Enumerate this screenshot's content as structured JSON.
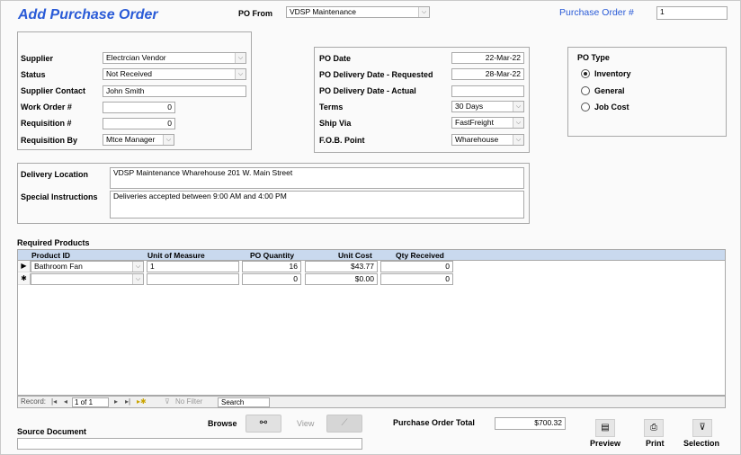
{
  "form": {
    "title": "Add Purchase Order",
    "po_from_label": "PO From",
    "po_from_value": "VDSP Maintenance",
    "po_number_label": "Purchase Order #",
    "po_number_value": "1"
  },
  "supplier_section": {
    "supplier_label": "Supplier",
    "supplier_value": "Electrcian Vendor",
    "status_label": "Status",
    "status_value": "Not Received",
    "contact_label": "Supplier Contact",
    "contact_value": "John Smith",
    "work_order_label": "Work Order #",
    "work_order_value": "0",
    "requisition_label": "Requisition #",
    "requisition_value": "0",
    "requisition_by_label": "Requisition By",
    "requisition_by_value": "Mtce Manager"
  },
  "dates_section": {
    "po_date_label": "PO Date",
    "po_date_value": "22-Mar-22",
    "delivery_requested_label": "PO Delivery Date - Requested",
    "delivery_requested_value": "28-Mar-22",
    "delivery_actual_label": "PO Delivery Date - Actual",
    "delivery_actual_value": "",
    "terms_label": "Terms",
    "terms_value": "30 Days",
    "ship_via_label": "Ship Via",
    "ship_via_value": "FastFreight",
    "fob_label": "F.O.B. Point",
    "fob_value": "Wharehouse"
  },
  "po_type": {
    "label": "PO Type",
    "options": [
      "Inventory",
      "General",
      "Job Cost"
    ],
    "selected": "Inventory"
  },
  "delivery": {
    "location_label": "Delivery Location",
    "location_value": "VDSP Maintenance Wharehouse 201 W. Main Street",
    "instructions_label": "Special Instructions",
    "instructions_value": "Deliveries accepted between 9:00 AM and 4:00 PM"
  },
  "products": {
    "section_label": "Required Products",
    "columns": [
      "Product ID",
      "Unit of Measure",
      "PO Quantity",
      "Unit Cost",
      "Qty Received"
    ],
    "rows": [
      {
        "selector": "▶",
        "product_id": "Bathroom Fan",
        "unit": "1",
        "quantity": "16",
        "unit_cost": "$43.77",
        "qty_received": "0"
      },
      {
        "selector": "✱",
        "product_id": "",
        "unit": "",
        "quantity": "0",
        "unit_cost": "$0.00",
        "qty_received": "0"
      }
    ]
  },
  "navigator": {
    "record_label": "Record:",
    "position": "1 of 1",
    "filter_label": "No Filter",
    "search_label": "Search"
  },
  "footer": {
    "browse_label": "Browse",
    "view_label": "View",
    "total_label": "Purchase Order Total",
    "total_value": "$700.32",
    "source_label": "Source Document",
    "source_value": "",
    "preview_label": "Preview",
    "print_label": "Print",
    "selection_label": "Selection"
  },
  "icons": {
    "binoculars": "binoculars-icon",
    "view": "view-icon",
    "preview": "preview-icon",
    "print": "printer-icon",
    "selection": "filter-icon"
  },
  "colors": {
    "title": "#2a5bd7",
    "grid_header": "#c9d9ee"
  }
}
